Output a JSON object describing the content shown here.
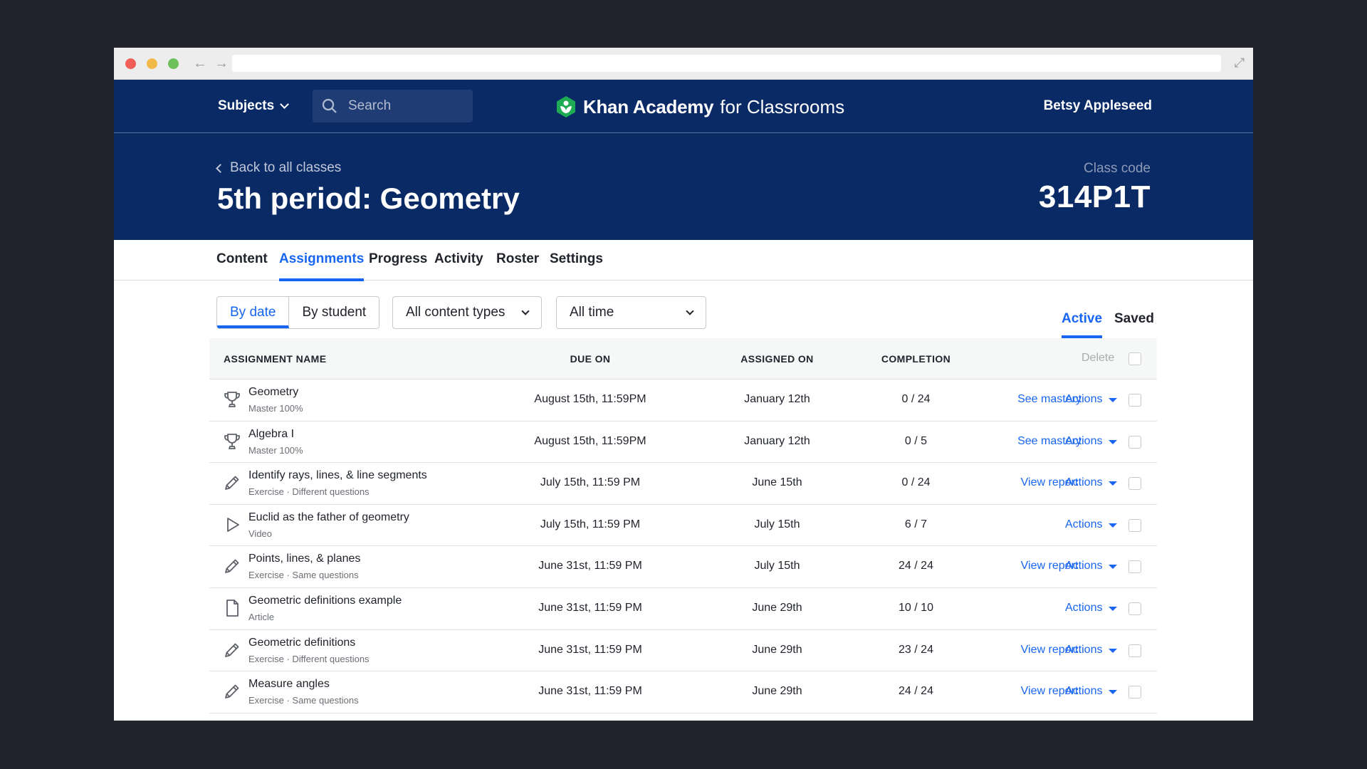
{
  "topnav": {
    "subjects_label": "Subjects",
    "search_placeholder": "Search",
    "logo_name": "Khan Academy",
    "logo_sub": "for Classrooms",
    "user_name": "Betsy Appleseed"
  },
  "class_header": {
    "back_label": "Back to all classes",
    "title": "5th period: Geometry",
    "code_label": "Class code",
    "code_value": "314P1T"
  },
  "tabs": [
    {
      "label": "Content",
      "active": false
    },
    {
      "label": "Assignments",
      "active": true
    },
    {
      "label": "Progress",
      "active": false
    },
    {
      "label": "Activity",
      "active": false
    },
    {
      "label": "Roster",
      "active": false
    },
    {
      "label": "Settings",
      "active": false
    }
  ],
  "filters": {
    "by_date": "By date",
    "by_student": "By student",
    "content_types": "All content types",
    "time_range": "All time",
    "status_active": "Active",
    "status_saved": "Saved"
  },
  "table": {
    "headers": {
      "name": "ASSIGNMENT NAME",
      "due": "DUE ON",
      "assigned": "ASSIGNED ON",
      "completion": "COMPLETION",
      "delete": "Delete"
    },
    "actions_label": "Actions",
    "rows": [
      {
        "icon": "trophy-icon",
        "name": "Geometry",
        "sub": "Master 100%",
        "due": "August 15th, 11:59PM",
        "assigned": "January 12th",
        "completion": "0 / 24",
        "link": "See mastery"
      },
      {
        "icon": "trophy-icon",
        "name": "Algebra I",
        "sub": "Master 100%",
        "due": "August 15th, 11:59PM",
        "assigned": "January 12th",
        "completion": "0 / 5",
        "link": "See mastery"
      },
      {
        "icon": "pencil-icon",
        "name": "Identify rays, lines, & line segments",
        "sub": "Exercise  ·  Different questions",
        "due": "July 15th, 11:59 PM",
        "assigned": "June 15th",
        "completion": "0 / 24",
        "link": "View report"
      },
      {
        "icon": "play-icon",
        "name": "Euclid as the father of geometry",
        "sub": "Video",
        "due": "July 15th, 11:59 PM",
        "assigned": "July 15th",
        "completion": "6 / 7",
        "link": ""
      },
      {
        "icon": "pencil-icon",
        "name": "Points, lines, & planes",
        "sub": "Exercise  ·  Same questions",
        "due": "June 31st, 11:59 PM",
        "assigned": "July 15th",
        "completion": "24 / 24",
        "link": "View report"
      },
      {
        "icon": "document-icon",
        "name": "Geometric definitions example",
        "sub": "Article",
        "due": "June 31st, 11:59 PM",
        "assigned": "June 29th",
        "completion": "10 / 10",
        "link": ""
      },
      {
        "icon": "pencil-icon",
        "name": "Geometric definitions",
        "sub": "Exercise  ·  Different questions",
        "due": "June 31st, 11:59 PM",
        "assigned": "June 29th",
        "completion": "23 / 24",
        "link": "View report"
      },
      {
        "icon": "pencil-icon",
        "name": "Measure angles",
        "sub": "Exercise  ·  Same questions",
        "due": "June 31st, 11:59 PM",
        "assigned": "June 29th",
        "completion": "24 / 24",
        "link": "View report"
      }
    ]
  },
  "colors": {
    "navy": "#0a2a66",
    "accent_blue": "#1865f2",
    "logo_green": "#1fab54"
  }
}
